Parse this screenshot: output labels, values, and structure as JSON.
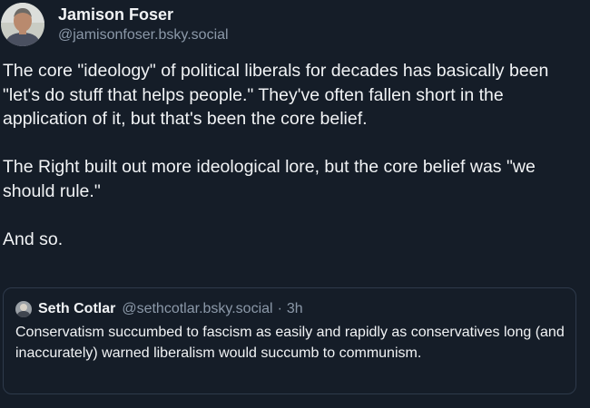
{
  "post": {
    "author": {
      "display_name": "Jamison Foser",
      "handle": "@jamisonfoser.bsky.social",
      "avatar_icon": "user-avatar-photo"
    },
    "paragraphs": [
      "The core \"ideology\" of political liberals for decades has basically been \"let's do stuff that helps people.\" They've often fallen short in the application of it, but that's been the core belief.",
      "The Right built out more ideological lore, but the core belief was \"we should rule.\"",
      "And so."
    ]
  },
  "quote": {
    "author": {
      "display_name": "Seth Cotlar",
      "handle": "@sethcotlar.bsky.social",
      "avatar_icon": "user-avatar-photo"
    },
    "separator": "·",
    "time": "3h",
    "text": "Conservatism succumbed to fascism as easily and rapidly as conservatives long (and inaccurately) warned liberalism would succumb to communism."
  },
  "colors": {
    "background": "#151d28",
    "text": "#f1f3f5",
    "muted": "#8b98a8",
    "border": "#2e3a4b"
  }
}
